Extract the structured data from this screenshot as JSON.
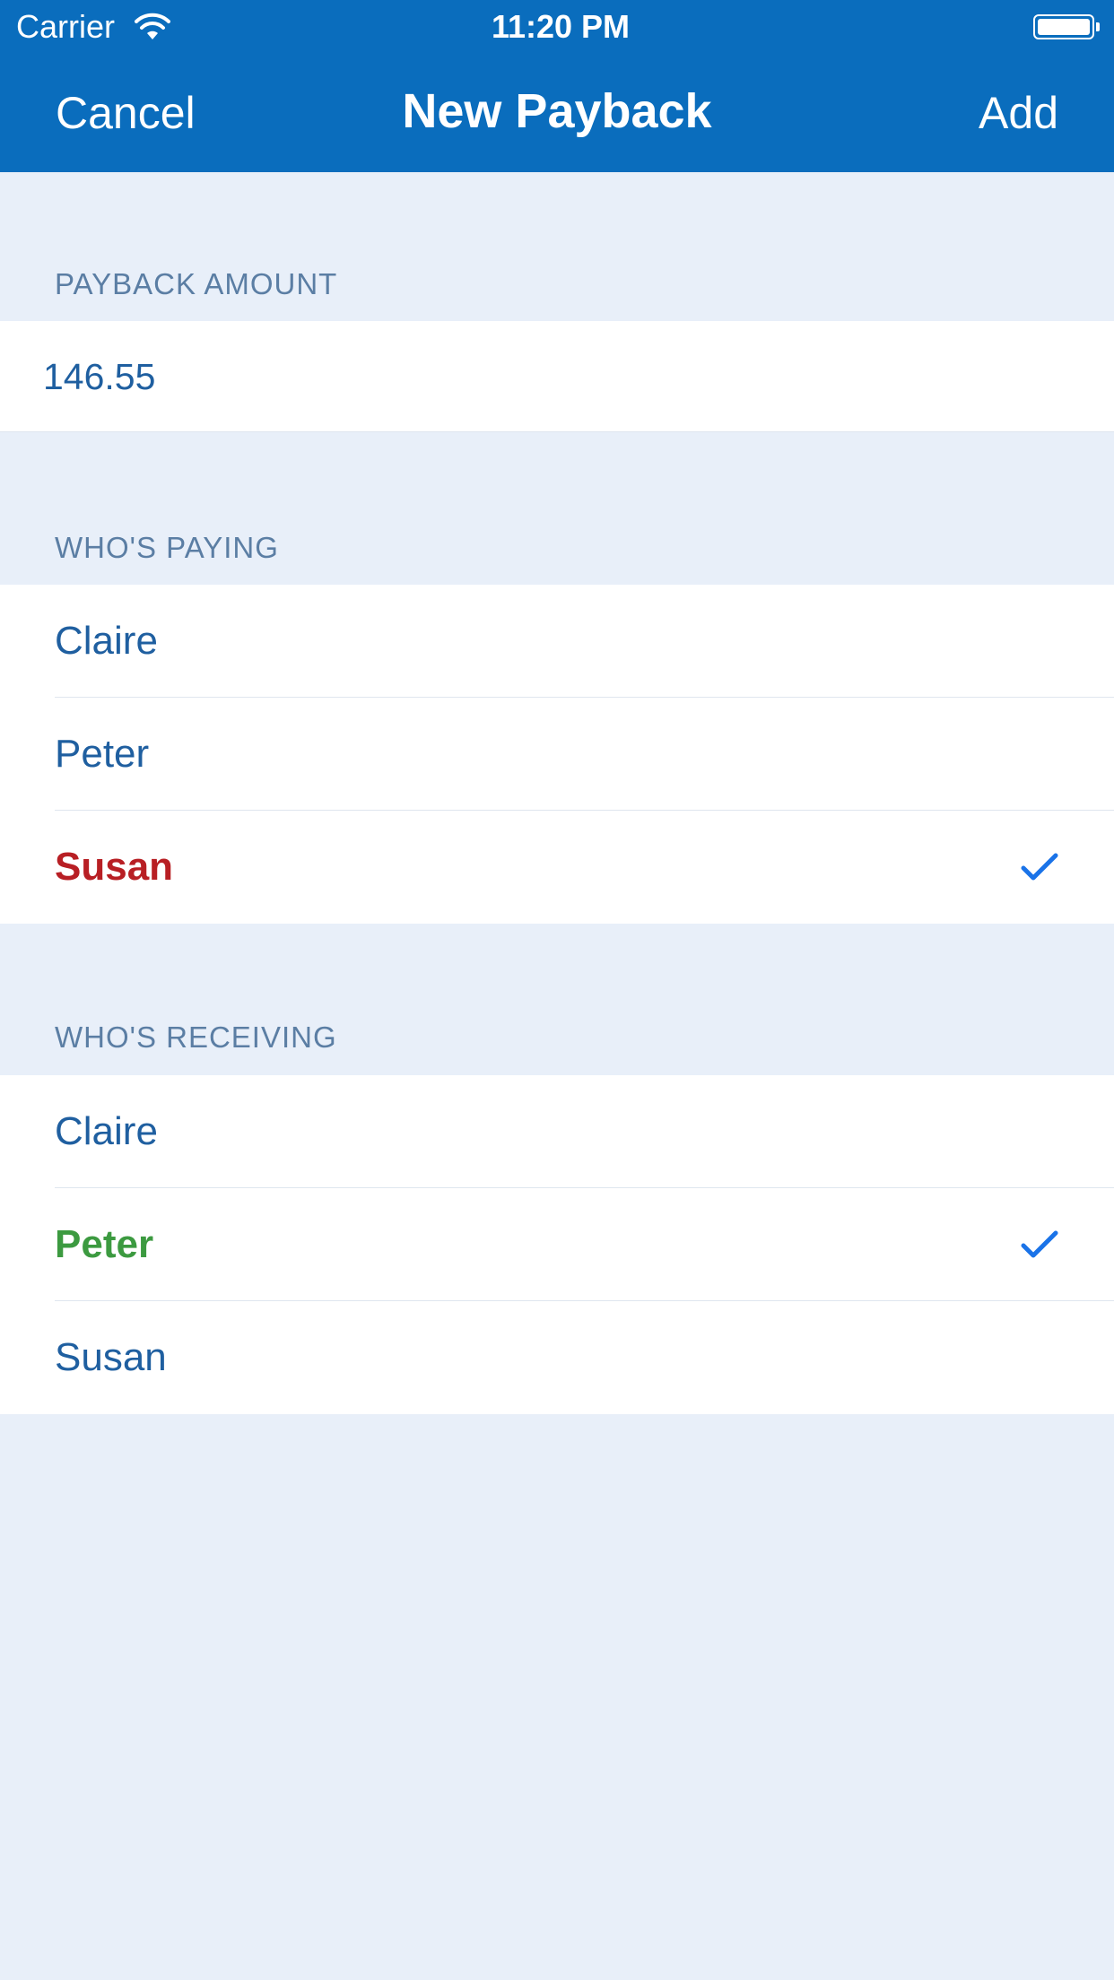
{
  "status_bar": {
    "carrier": "Carrier",
    "time": "11:20 PM"
  },
  "nav": {
    "cancel": "Cancel",
    "title": "New Payback",
    "add": "Add"
  },
  "amount_section": {
    "header": "PAYBACK AMOUNT",
    "value": "146.55"
  },
  "paying_section": {
    "header": "WHO'S PAYING",
    "rows": [
      {
        "name": "Claire",
        "selected": false
      },
      {
        "name": "Peter",
        "selected": false
      },
      {
        "name": "Susan",
        "selected": true
      }
    ]
  },
  "receiving_section": {
    "header": "WHO'S RECEIVING",
    "rows": [
      {
        "name": "Claire",
        "selected": false
      },
      {
        "name": "Peter",
        "selected": true
      },
      {
        "name": "Susan",
        "selected": false
      }
    ]
  },
  "colors": {
    "nav_bar": "#0a6dbd",
    "background": "#e8eff9",
    "row_text": "#1f5fa0",
    "section_header": "#5b7ea4",
    "payer_selected": "#b81f24",
    "receiver_selected": "#3c9a40",
    "checkmark": "#1a73e8"
  },
  "icons": {
    "wifi": "wifi-icon",
    "battery": "battery-icon",
    "check": "checkmark-icon"
  }
}
